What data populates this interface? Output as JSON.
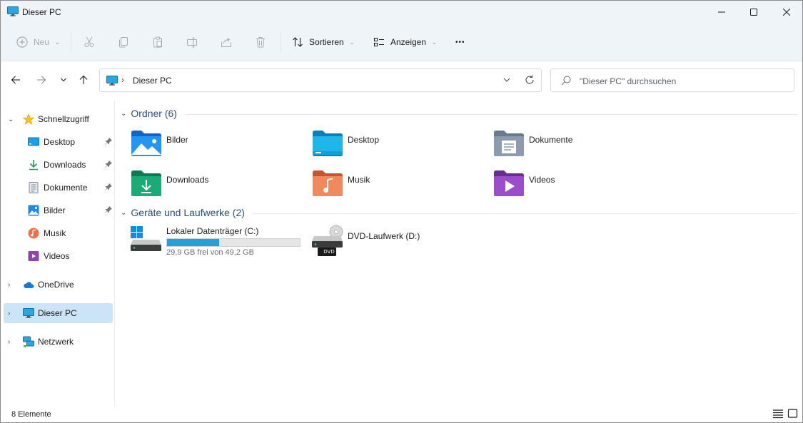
{
  "window": {
    "title": "Dieser PC",
    "controls": {
      "minimize": "minimize",
      "maximize": "maximize",
      "close": "close"
    }
  },
  "toolbar": {
    "new_label": "Neu",
    "sort_label": "Sortieren",
    "view_label": "Anzeigen",
    "more_label": "•••",
    "icons": [
      "plus-circle-icon",
      "cut-icon",
      "copy-icon",
      "paste-icon",
      "rename-icon",
      "share-icon",
      "delete-icon",
      "sort-icon",
      "view-icon"
    ]
  },
  "address": {
    "breadcrumb": "Dieser PC",
    "search_placeholder": "\"Dieser PC\" durchsuchen"
  },
  "sidebar": {
    "quick_access": {
      "label": "Schnellzugriff"
    },
    "pinned": [
      {
        "label": "Desktop"
      },
      {
        "label": "Downloads"
      },
      {
        "label": "Dokumente"
      },
      {
        "label": "Bilder"
      }
    ],
    "unpinned": [
      {
        "label": "Musik"
      },
      {
        "label": "Videos"
      }
    ],
    "onedrive": {
      "label": "OneDrive"
    },
    "this_pc": {
      "label": "Dieser PC"
    },
    "network": {
      "label": "Netzwerk"
    }
  },
  "content": {
    "folders_header": "Ordner (6)",
    "folders": [
      {
        "name": "Bilder",
        "icon": "pictures-folder-icon"
      },
      {
        "name": "Desktop",
        "icon": "desktop-folder-icon"
      },
      {
        "name": "Dokumente",
        "icon": "documents-folder-icon"
      },
      {
        "name": "Downloads",
        "icon": "downloads-folder-icon"
      },
      {
        "name": "Musik",
        "icon": "music-folder-icon"
      },
      {
        "name": "Videos",
        "icon": "videos-folder-icon"
      }
    ],
    "drives_header": "Geräte und Laufwerke (2)",
    "drives": [
      {
        "name": "Lokaler Datenträger (C:)",
        "free": "29,9 GB frei von 49,2 GB",
        "used_fraction": 0.39
      },
      {
        "name": "DVD-Laufwerk (D:)",
        "badge": "DVD"
      }
    ]
  },
  "statusbar": {
    "count": "8 Elemente"
  },
  "colors": {
    "chrome": "#eff4f9",
    "selected": "#cce4f7",
    "accent": "#26a0da",
    "group_header": "#2b4c7e"
  }
}
